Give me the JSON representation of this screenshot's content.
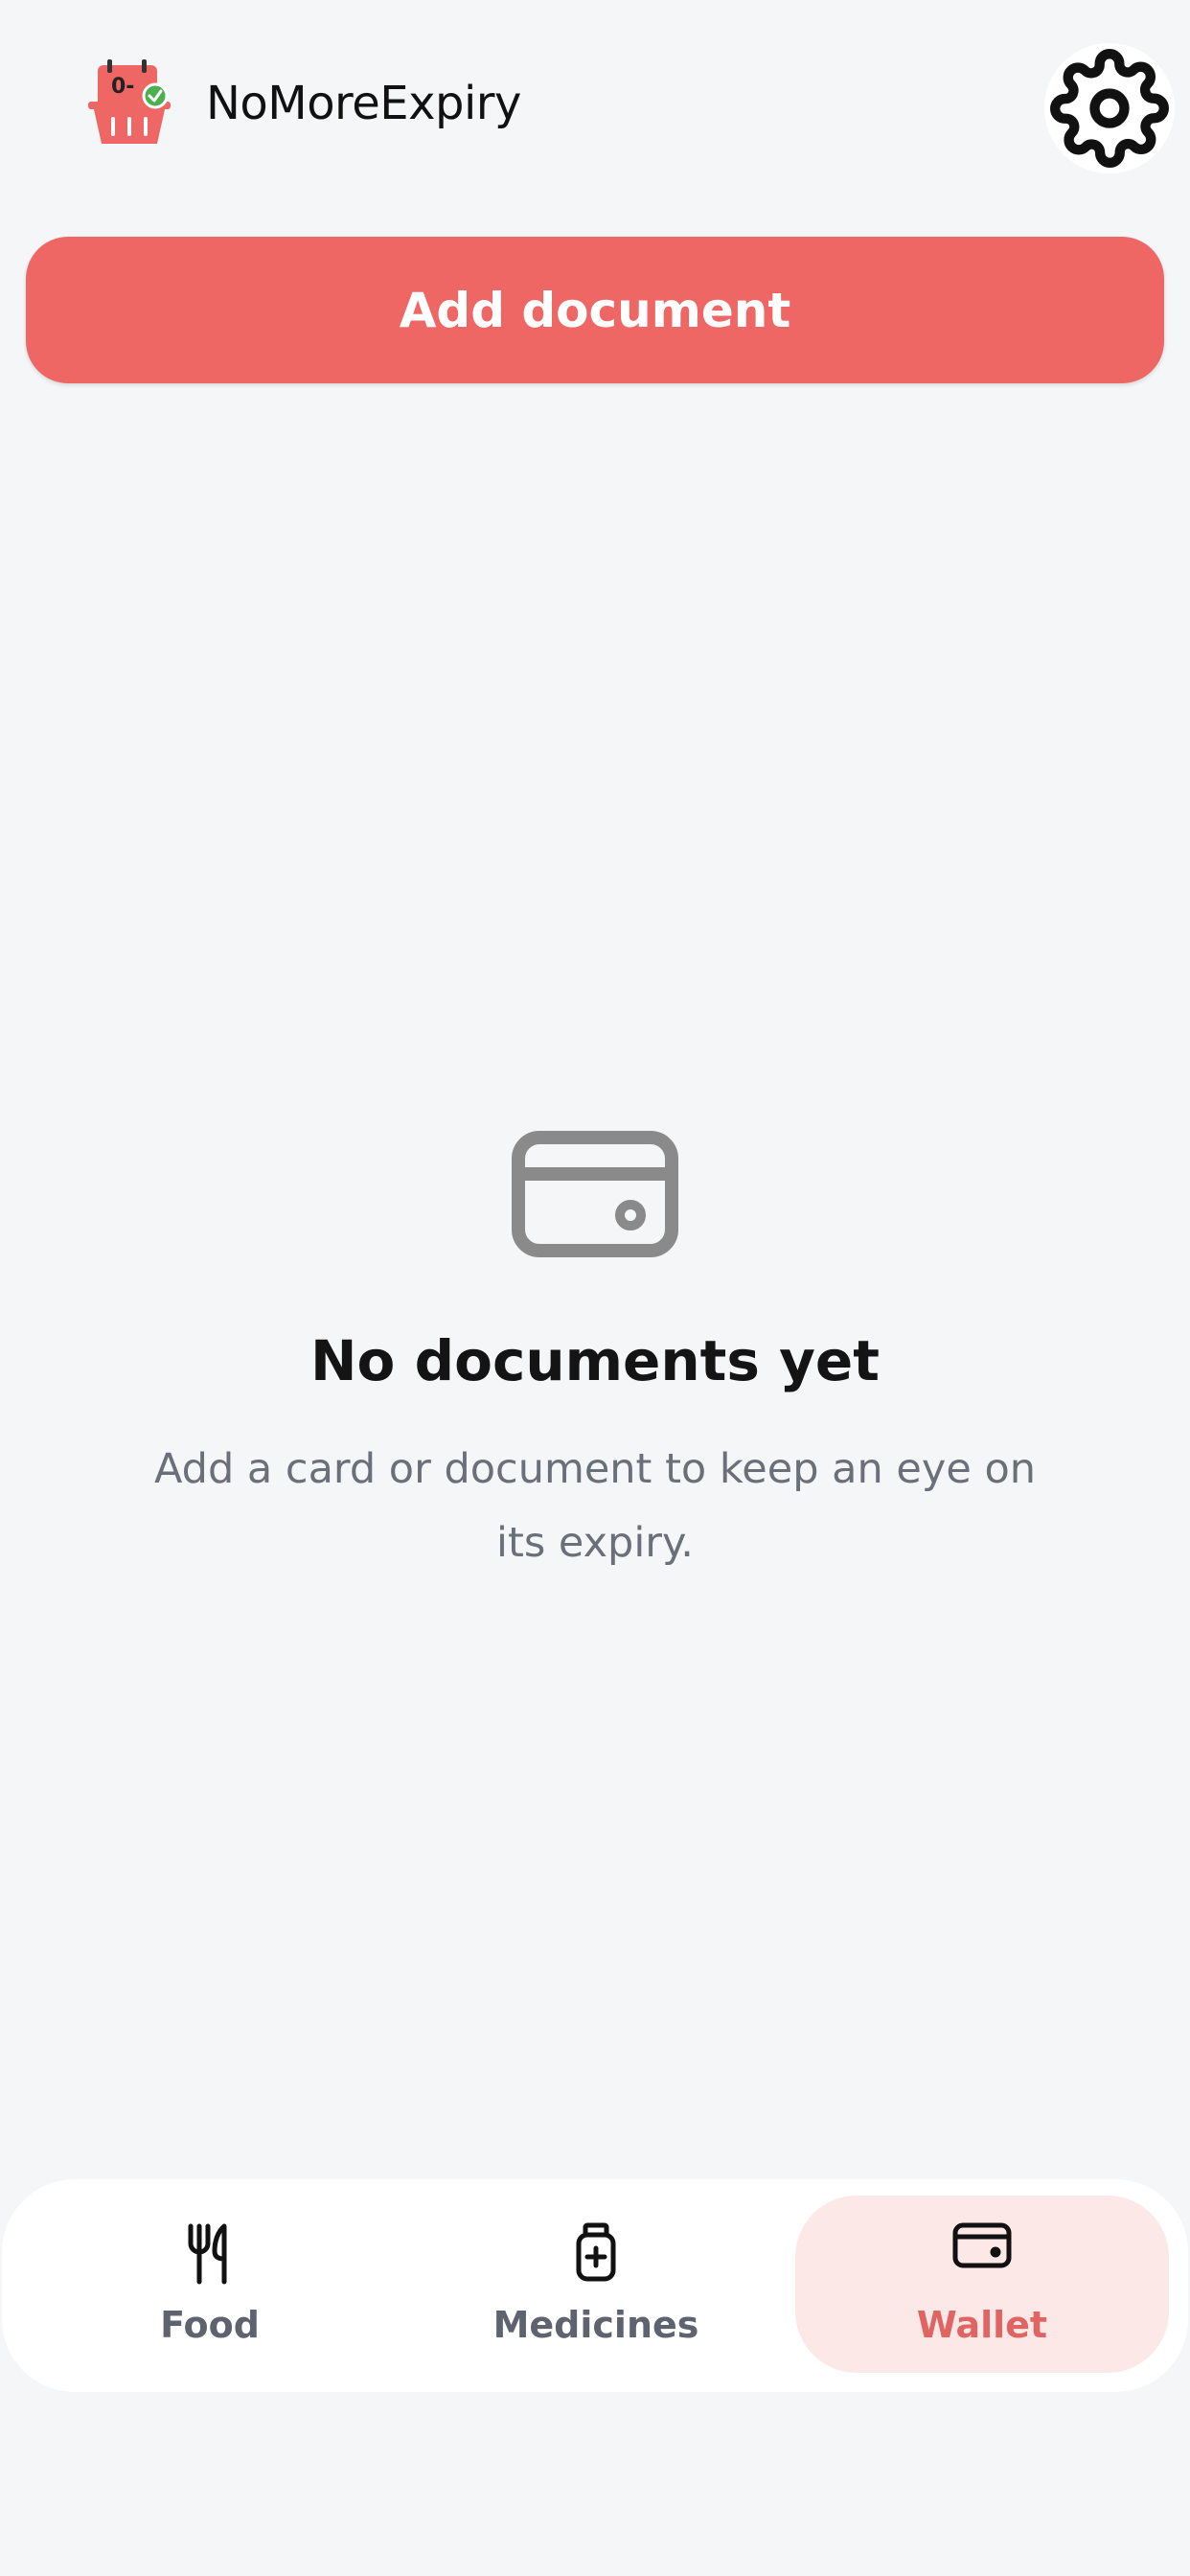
{
  "header": {
    "app_title": "NoMoreExpiry",
    "logo_icon": "basket-calendar-logo-icon",
    "logo_badge_text": "0-",
    "settings_icon": "gear-icon"
  },
  "toolbar": {
    "add_label": "Add document"
  },
  "empty_state": {
    "icon": "wallet-card-icon",
    "title": "No documents yet",
    "description": "Add a card or document to keep an eye on its expiry."
  },
  "bottom_nav": {
    "items": [
      {
        "label": "Food",
        "icon": "fork-knife-icon",
        "active": false
      },
      {
        "label": "Medicines",
        "icon": "medicine-bottle-icon",
        "active": false
      },
      {
        "label": "Wallet",
        "icon": "wallet-icon",
        "active": true
      }
    ]
  },
  "colors": {
    "accent": "#ee6765",
    "background": "#f5f6f8",
    "active_tab_bg": "#fde8e8",
    "inactive_tab_text": "#5f6370",
    "active_tab_text": "#e06462",
    "empty_icon": "#8a8a8a"
  }
}
